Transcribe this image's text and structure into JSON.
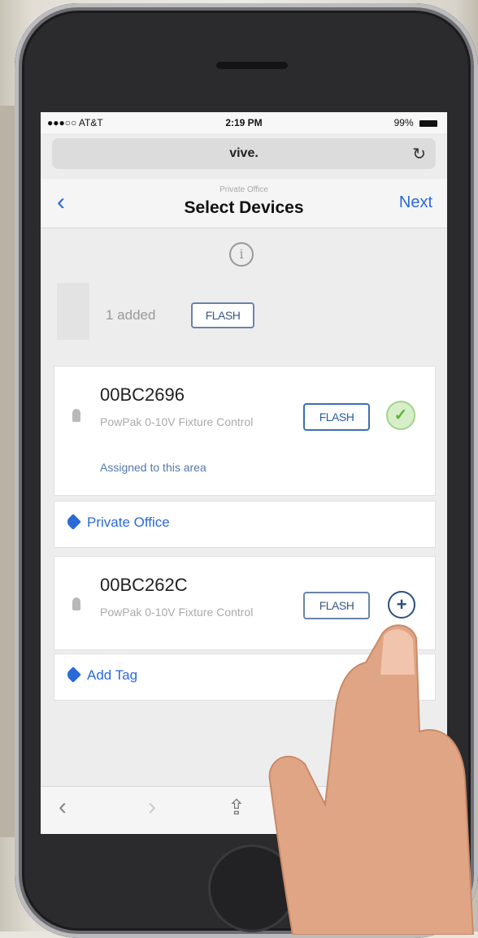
{
  "status": {
    "carrier": "●●●○○ AT&T",
    "time": "2:19 PM",
    "battery": "99%"
  },
  "browser": {
    "url": "vive.",
    "reload_icon": "reload-icon"
  },
  "nav": {
    "subtitle": "Private Office",
    "title": "Select Devices",
    "next_label": "Next",
    "back_icon": "chevron-left-icon"
  },
  "summary": {
    "added_text": "1 added",
    "flash_label": "FLASH"
  },
  "devices": [
    {
      "id": "00BC2696",
      "description": "PowPak 0-10V Fixture Control",
      "status": "Assigned to this area",
      "flash_label": "FLASH",
      "state_icon": "check-icon",
      "tag_label": "Private Office"
    },
    {
      "id": "00BC262C",
      "description": "PowPak 0-10V Fixture Control",
      "flash_label": "FLASH",
      "state_icon": "plus-icon",
      "tag_label": "Add Tag"
    }
  ],
  "colors": {
    "accent": "#2a6ad8",
    "check_green": "#5fb33e"
  }
}
